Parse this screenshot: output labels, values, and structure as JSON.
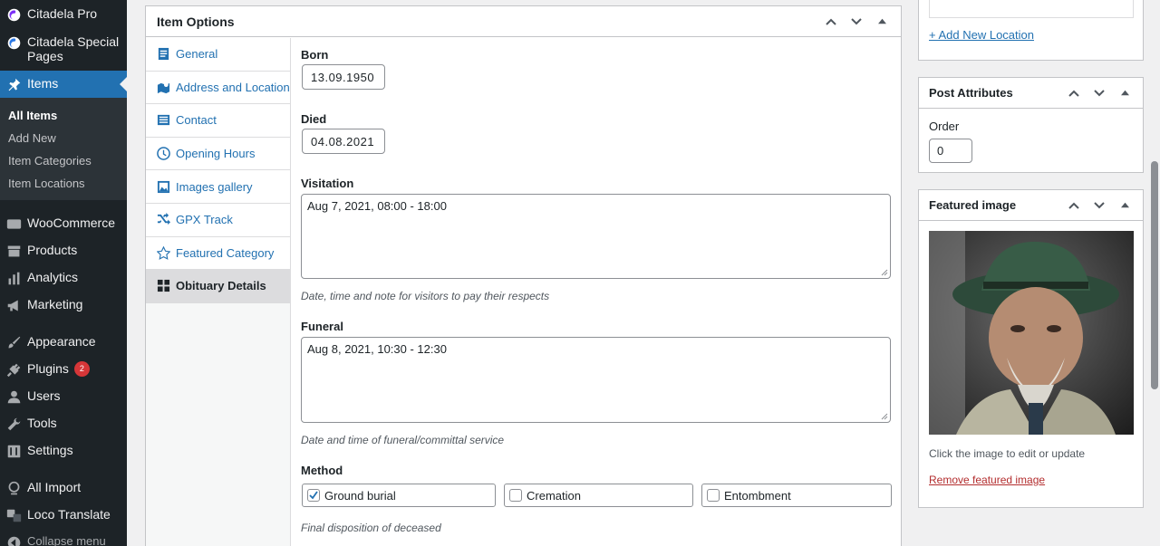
{
  "sidebar": {
    "citadela_pro": "Citadela Pro",
    "citadela_special": "Citadela Special Pages",
    "items": "Items",
    "sub": [
      "All Items",
      "Add New",
      "Item Categories",
      "Item Locations"
    ],
    "woocommerce": "WooCommerce",
    "products": "Products",
    "analytics": "Analytics",
    "marketing": "Marketing",
    "appearance": "Appearance",
    "plugins": "Plugins",
    "plugins_badge": "2",
    "users": "Users",
    "tools": "Tools",
    "settings": "Settings",
    "all_import": "All Import",
    "loco_translate": "Loco Translate",
    "collapse": "Collapse menu"
  },
  "item_options": {
    "title": "Item Options",
    "tabs": [
      "General",
      "Address and Location",
      "Contact",
      "Opening Hours",
      "Images gallery",
      "GPX Track",
      "Featured Category",
      "Obituary Details"
    ],
    "born_label": "Born",
    "born_value": "13.09.1950",
    "died_label": "Died",
    "died_value": "04.08.2021",
    "visitation_label": "Visitation",
    "visitation_value": "Aug 7, 2021, 08:00 - 18:00",
    "visitation_hint": "Date, time and note for visitors to pay their respects",
    "funeral_label": "Funeral",
    "funeral_value": "Aug 8, 2021, 10:30 - 12:30",
    "funeral_hint": "Date and time of funeral/committal service",
    "method_label": "Method",
    "methods": [
      {
        "label": "Ground burial",
        "checked": true
      },
      {
        "label": "Cremation",
        "checked": false
      },
      {
        "label": "Entombment",
        "checked": false
      }
    ],
    "method_hint": "Final disposition of deceased"
  },
  "location_box": {
    "add_link": "+ Add New Location"
  },
  "post_attributes": {
    "title": "Post Attributes",
    "order_label": "Order",
    "order_value": "0"
  },
  "featured_image": {
    "title": "Featured image",
    "hint": "Click the image to edit or update",
    "remove_link": "Remove featured image"
  },
  "colors": {
    "accent": "#2271b1",
    "sidebar_bg": "#1d2327",
    "badge": "#d63638"
  }
}
